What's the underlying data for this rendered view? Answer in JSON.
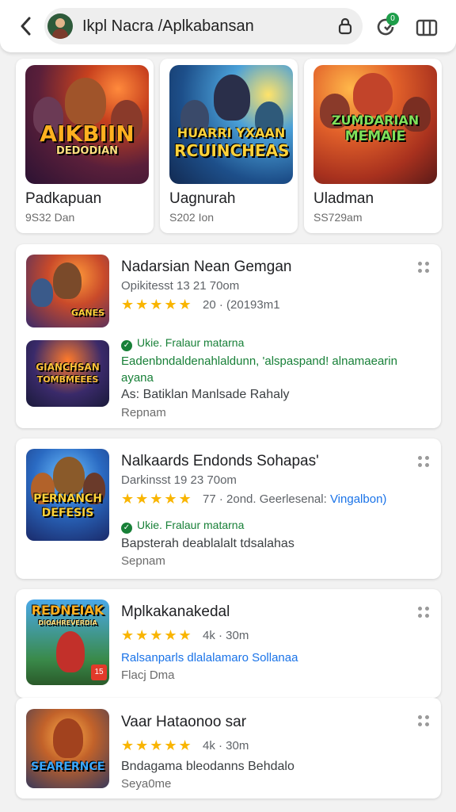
{
  "header": {
    "search_text": "Ikpl Nacra /Aplkabansan",
    "notif_count": "0"
  },
  "featured": [
    {
      "art_title": "AIKBIIN",
      "art_sub": "DEDODIAN",
      "title": "Padkapuan",
      "sub": "9S32 Dan"
    },
    {
      "art_title": "HUARRI YXAAN",
      "art_sub": "RCUINCHEAS",
      "title": "Uagnurah",
      "sub": "S202 Ion"
    },
    {
      "art_title": "ZUMDARIAN",
      "art_sub": "MEMAIE",
      "title": "Uladman",
      "sub": "SS729am"
    }
  ],
  "cards": [
    {
      "title": "Nadarsian Nean Gemgan",
      "meta": "Opikitesst 13 21 70om",
      "stars": "★★★★★",
      "rating_note": "20 · (20193m1",
      "art_label": "GANES",
      "art2_title": "GIANCHSAN",
      "art2_sub": "TOMBMEEES",
      "verified": "Ukie. Fralaur matarna",
      "green_text": "Eadenbndaldenahlaldunn, 'alspaspand! alnamaearin ayana",
      "desc": "As: Batiklan Manlsade Rahaly",
      "footer": "Repnam"
    },
    {
      "title": "Nalkaards Endonds Sohapas'",
      "meta": "Darkinsst 19 23 70om",
      "stars": "★★★★★",
      "rating_note": "77 · 2ond. Geerlesenal:",
      "rating_link": "Vingalbon)",
      "art_title": "PERNANCH",
      "art_sub": "DEFESIS",
      "verified": "Ukie. Fralaur matarna",
      "desc": "Bapsterah deablalalt tdsalahas",
      "footer": "Sepnam"
    },
    {
      "title": "Mplkakanakedal",
      "stars": "★★★★★",
      "rating_note": "4k · 30m",
      "art_title": "REDNEIAK",
      "art_sub": "DIOAHREVERDIA",
      "art_badge": "15",
      "blue_text": "Ralsanparls dlalalamaro Sollanaa",
      "footer": "Flacj Dma"
    },
    {
      "title": "Vaar Hataonoo sar",
      "stars": "★★★★★",
      "rating_note": "4k · 30m",
      "art_title": "SEARERNCE",
      "desc": "Bndagama bleodanns Behdalo",
      "footer": "Seya0me"
    }
  ]
}
